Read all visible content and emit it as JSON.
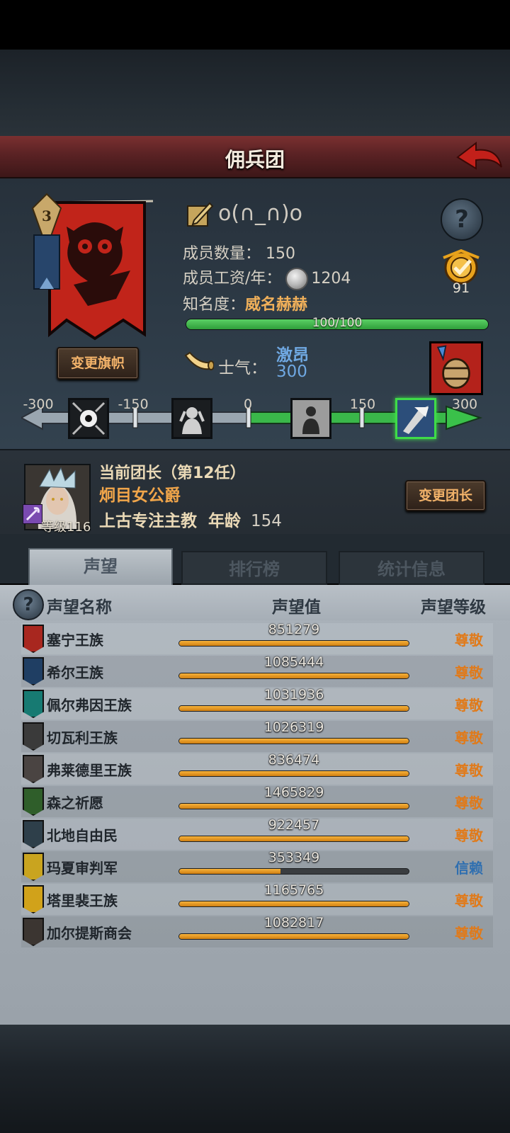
{
  "header": {
    "title": "佣兵团"
  },
  "guild": {
    "name": "o(∩_∩)o",
    "members_label": "成员数量：",
    "members_value": "150",
    "salary_label": "成员工资/年：",
    "salary_value": "1204",
    "fame_label": "知名度：",
    "fame_value": "威名赫赫",
    "fame_progress_text": "100/100",
    "fame_progress_fraction": 1.0,
    "badge_count": "91",
    "change_banner_label": "变更旗帜",
    "banner_rank": "3"
  },
  "morale": {
    "label": "士气：",
    "state": "激昂",
    "value": "300",
    "scale_labels": [
      "-300",
      "-150",
      "0",
      "150",
      "300"
    ],
    "scale_min": -300,
    "scale_max": 300,
    "current": 300
  },
  "leader": {
    "title": "当前团长（第12任）",
    "name": "炯目女公爵",
    "level_text": "等级116",
    "class_label": "上古专注主教",
    "age_label": "年龄",
    "age_value": "154",
    "change_leader_label": "变更团长"
  },
  "tabs": [
    {
      "label": "声望",
      "active": true
    },
    {
      "label": "排行榜",
      "active": false
    },
    {
      "label": "统计信息",
      "active": false
    }
  ],
  "reputation": {
    "col_name": "声望名称",
    "col_value": "声望值",
    "col_level": "声望等级",
    "rows": [
      {
        "name": "塞宁王族",
        "value": "851279",
        "fill": 1.0,
        "level": "尊敬",
        "level_color": "#e07a1a",
        "icon_color": "#a8271f"
      },
      {
        "name": "希尔王族",
        "value": "1085444",
        "fill": 1.0,
        "level": "尊敬",
        "level_color": "#e07a1a",
        "icon_color": "#1f3e63"
      },
      {
        "name": "佩尔弗因王族",
        "value": "1031936",
        "fill": 1.0,
        "level": "尊敬",
        "level_color": "#e07a1a",
        "icon_color": "#177a72"
      },
      {
        "name": "切瓦利王族",
        "value": "1026319",
        "fill": 1.0,
        "level": "尊敬",
        "level_color": "#e07a1a",
        "icon_color": "#3a3a3a"
      },
      {
        "name": "弗莱德里王族",
        "value": "836474",
        "fill": 1.0,
        "level": "尊敬",
        "level_color": "#e07a1a",
        "icon_color": "#4a4442"
      },
      {
        "name": "森之祈愿",
        "value": "1465829",
        "fill": 1.0,
        "level": "尊敬",
        "level_color": "#e07a1a",
        "icon_color": "#2f5e2a"
      },
      {
        "name": "北地自由民",
        "value": "922457",
        "fill": 1.0,
        "level": "尊敬",
        "level_color": "#e07a1a",
        "icon_color": "#2e3f4a"
      },
      {
        "name": "玛夏审判军",
        "value": "353349",
        "fill": 0.44,
        "level": "信赖",
        "level_color": "#2f6fb0",
        "icon_color": "#c9a41f"
      },
      {
        "name": "塔里裴王族",
        "value": "1165765",
        "fill": 1.0,
        "level": "尊敬",
        "level_color": "#e07a1a",
        "icon_color": "#d1a21a"
      },
      {
        "name": "加尔提斯商会",
        "value": "1082817",
        "fill": 1.0,
        "level": "尊敬",
        "level_color": "#e07a1a",
        "icon_color": "#3b3531"
      }
    ]
  }
}
